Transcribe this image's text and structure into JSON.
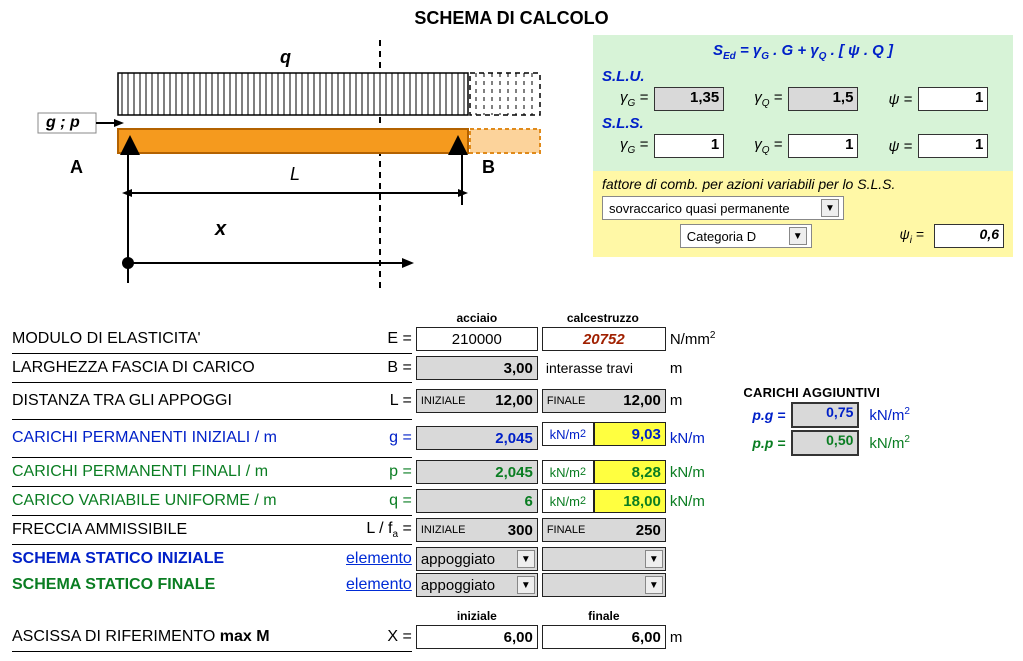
{
  "title": "SCHEMA DI CALCOLO",
  "diagram": {
    "load_q": "q",
    "load_gp": "g ; p",
    "A": "A",
    "B": "B",
    "L": "L",
    "x": "x"
  },
  "formula": {
    "hdr_left": "S",
    "hdr_sub": "Ed",
    "hdr_eq": " =   γ",
    "hdr_sub2": "G",
    "hdr_mid": " . G + γ",
    "hdr_sub3": "Q",
    "hdr_end": " . [ ψ . Q ]",
    "slu": "S.L.U.",
    "sls": "S.L.S.",
    "gG": "γ",
    "gG_sub": "G",
    "gQ": "γ",
    "gQ_sub": "Q",
    "psi": "ψ",
    "eq": " =",
    "slu_gG": "1,35",
    "slu_gQ": "1,5",
    "slu_psi": "1",
    "sls_gG": "1",
    "sls_gQ": "1",
    "sls_psi": "1"
  },
  "variab": {
    "note": "fattore di comb. per azioni variabili per lo S.L.S.",
    "sel1": "sovraccarico quasi permanente",
    "sel2": "Categoria D",
    "psi_i_label": "ψ",
    "psi_i_sub": "i",
    "psi_i_eq": "  =",
    "psi_i_val": "0,6"
  },
  "cols": {
    "acciaio": "acciaio",
    "cls": "calcestruzzo"
  },
  "rows": {
    "modE": {
      "label": "MODULO DI ELASTICITA'",
      "sym": "E =",
      "v1": "210000",
      "v2": "20752",
      "unit": "N/mm",
      "unit_sup": "2"
    },
    "B": {
      "label": "LARGHEZZA FASCIA DI CARICO",
      "sym": "B =",
      "v1": "3,00",
      "v2": "interasse travi",
      "unit": "m"
    },
    "L": {
      "label": "DISTANZA TRA GLI APPOGGI",
      "sym": "L =",
      "tag1": "INIZIALE",
      "v1": "12,00",
      "tag2": "FINALE",
      "v2": "12,00",
      "unit": "m"
    },
    "g": {
      "label": "CARICHI PERMANENTI INIZIALI / m",
      "sym": "g =",
      "v1": "2,045",
      "u1": "kN/m",
      "v2": "9,03",
      "u2": "kN/m"
    },
    "p": {
      "label": "CARICHI PERMANENTI FINALI / m",
      "sym": "p =",
      "v1": "2,045",
      "u1": "kN/m",
      "v2": "8,28",
      "u2": "kN/m"
    },
    "q": {
      "label": "CARICO VARIABILE UNIFORME / m",
      "sym": "q =",
      "v1": "6",
      "u1": "kN/m",
      "v2": "18,00",
      "u2": "kN/m"
    },
    "fa": {
      "label": "FRECCIA AMMISSIBILE",
      "sym": "L / f",
      "sym_sub": "a",
      "sym_eq": " =",
      "tag1": "INIZIALE",
      "v1": "300",
      "tag2": "FINALE",
      "v2": "250"
    },
    "ssi": {
      "label": "SCHEMA STATICO INIZIALE",
      "link": "elemento",
      "v1": "appoggiato"
    },
    "ssf": {
      "label": "SCHEMA STATICO FINALE",
      "link": "elemento",
      "v1": "appoggiato"
    }
  },
  "side": {
    "title": "CARICHI AGGIUNTIVI",
    "pg_label": "p.g =",
    "pg_val": "0,75",
    "pp_label": "p.p =",
    "pp_val": "0,50",
    "unit": "kN/m",
    "unit_sup": "2"
  },
  "xrow": {
    "ini": "iniziale",
    "fin": "finale",
    "label": "ASCISSA DI RIFERIMENTO",
    "maxm": "  max M",
    "sym": "X =",
    "v1": "6,00",
    "v2": "6,00",
    "unit": "m"
  },
  "sup2": "2"
}
